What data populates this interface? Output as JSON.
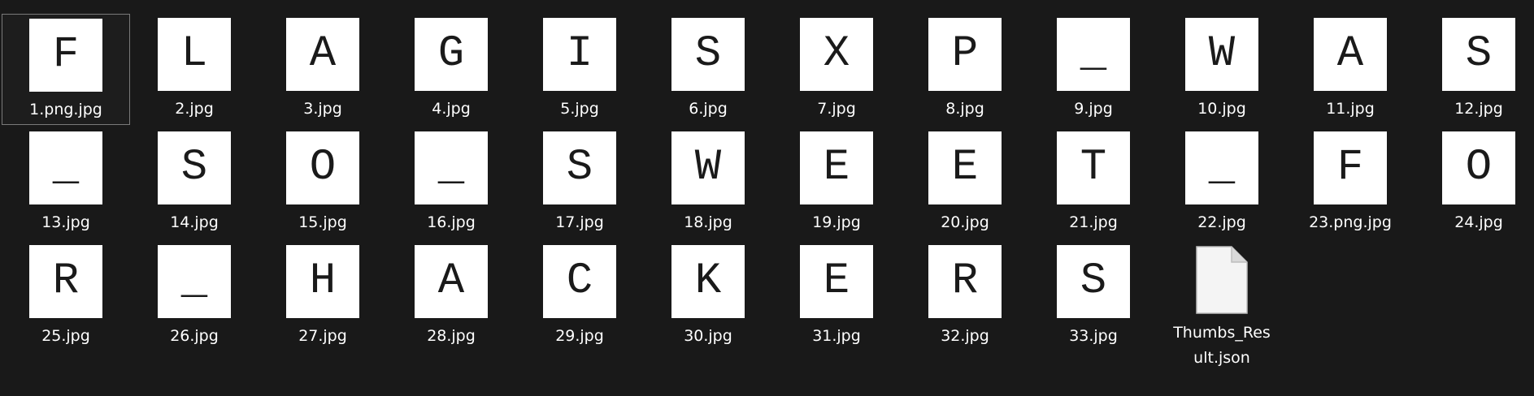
{
  "files": [
    {
      "thumb_text": "F",
      "name": "1.png.jpg",
      "selected": true
    },
    {
      "thumb_text": "L",
      "name": "2.jpg"
    },
    {
      "thumb_text": "A",
      "name": "3.jpg"
    },
    {
      "thumb_text": "G",
      "name": "4.jpg"
    },
    {
      "thumb_text": "I",
      "name": "5.jpg"
    },
    {
      "thumb_text": "S",
      "name": "6.jpg"
    },
    {
      "thumb_text": "X",
      "name": "7.jpg"
    },
    {
      "thumb_text": "P",
      "name": "8.jpg"
    },
    {
      "thumb_text": "_",
      "name": "9.jpg"
    },
    {
      "thumb_text": "W",
      "name": "10.jpg"
    },
    {
      "thumb_text": "A",
      "name": "11.jpg"
    },
    {
      "thumb_text": "S",
      "name": "12.jpg"
    },
    {
      "thumb_text": "_",
      "name": "13.jpg"
    },
    {
      "thumb_text": "S",
      "name": "14.jpg"
    },
    {
      "thumb_text": "O",
      "name": "15.jpg"
    },
    {
      "thumb_text": "_",
      "name": "16.jpg"
    },
    {
      "thumb_text": "S",
      "name": "17.jpg"
    },
    {
      "thumb_text": "W",
      "name": "18.jpg"
    },
    {
      "thumb_text": "E",
      "name": "19.jpg"
    },
    {
      "thumb_text": "E",
      "name": "20.jpg"
    },
    {
      "thumb_text": "T",
      "name": "21.jpg"
    },
    {
      "thumb_text": "_",
      "name": "22.jpg"
    },
    {
      "thumb_text": "F",
      "name": "23.png.jpg"
    },
    {
      "thumb_text": "O",
      "name": "24.jpg"
    },
    {
      "thumb_text": "R",
      "name": "25.jpg"
    },
    {
      "thumb_text": "_",
      "name": "26.jpg"
    },
    {
      "thumb_text": "H",
      "name": "27.jpg"
    },
    {
      "thumb_text": "A",
      "name": "28.jpg"
    },
    {
      "thumb_text": "C",
      "name": "29.jpg"
    },
    {
      "thumb_text": "K",
      "name": "30.jpg"
    },
    {
      "thumb_text": "E",
      "name": "31.jpg"
    },
    {
      "thumb_text": "R",
      "name": "32.jpg"
    },
    {
      "thumb_text": "S",
      "name": "33.jpg"
    },
    {
      "thumb_text": "",
      "name": "Thumbs_Result.json",
      "icon": "document-icon"
    }
  ],
  "colors": {
    "background": "#191919",
    "text": "#ffffff",
    "thumbnail": "#ffffff",
    "selection_border": "#7a7a7a"
  }
}
